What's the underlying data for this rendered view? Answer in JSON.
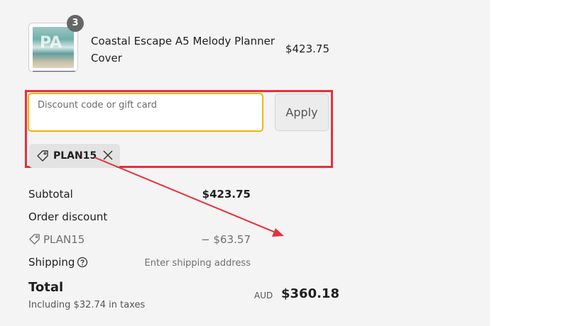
{
  "cart_item": {
    "quantity": "3",
    "name": "Coastal Escape A5 Melody Planner Cover",
    "price": "$423.75",
    "thumbnail_icon": "product-thumbnail"
  },
  "discount": {
    "placeholder": "Discount code or gift card",
    "apply_label": "Apply",
    "applied_code": "PLAN15"
  },
  "summary": {
    "subtotal_label": "Subtotal",
    "subtotal_value": "$423.75",
    "order_discount_label": "Order discount",
    "discount_code": "PLAN15",
    "discount_value": "− $63.57",
    "shipping_label": "Shipping",
    "shipping_value": "Enter shipping address",
    "total_label": "Total",
    "tax_note": "Including $32.74 in taxes",
    "currency": "AUD",
    "total_value": "$360.18"
  },
  "colors": {
    "highlight": "#e8303a",
    "input_focus": "#f0b400",
    "panel_bg": "#f4f4f4"
  }
}
